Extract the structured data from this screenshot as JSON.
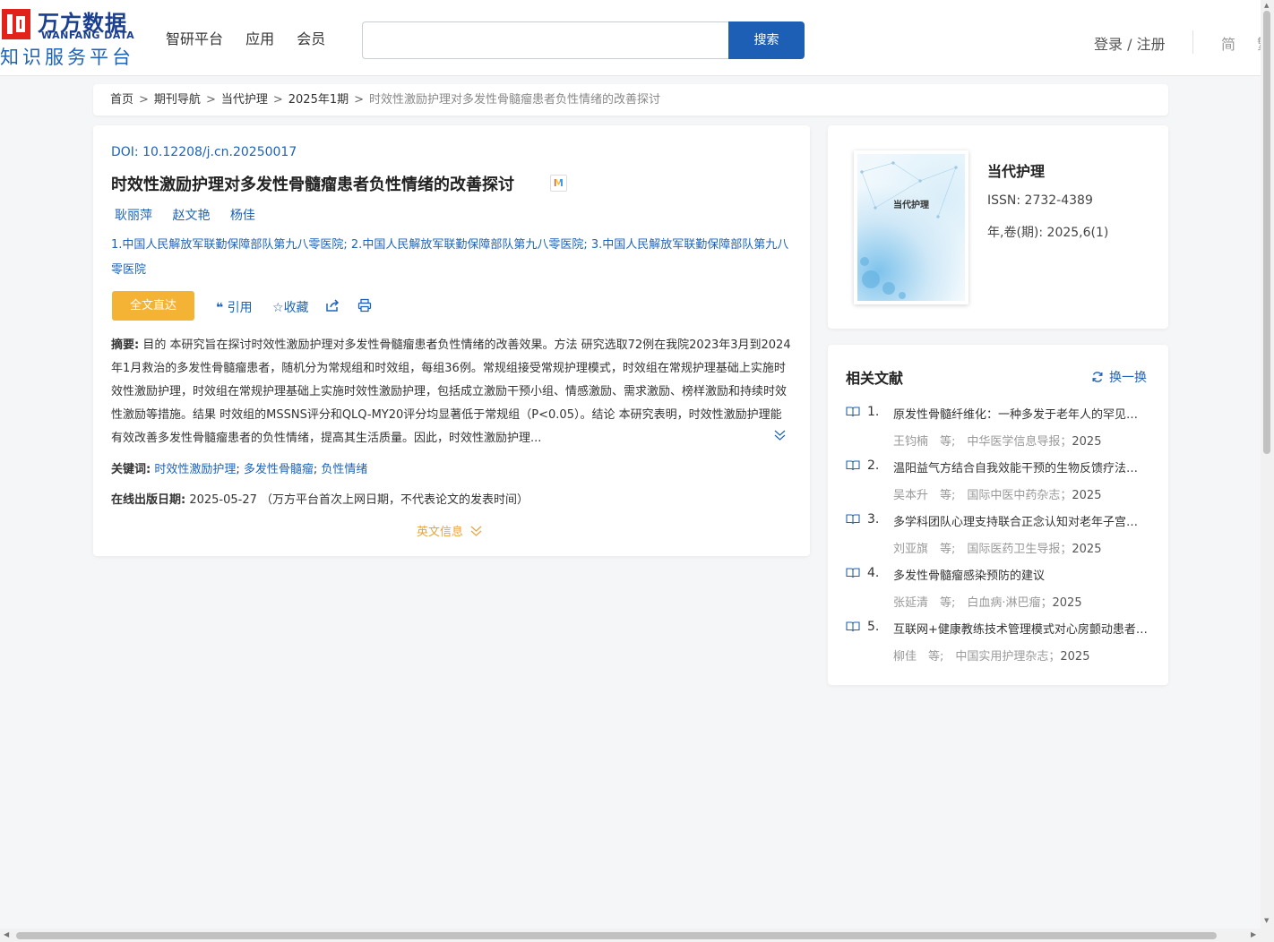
{
  "header": {
    "logo_cn": "万方数据",
    "logo_en": "WANFANG DATA",
    "logo_sub": "知识服务平台",
    "nav": [
      "智研平台",
      "应用",
      "会员"
    ],
    "search_placeholder": "",
    "search_button": "搜索",
    "login": "登录 / 注册",
    "lang": "简",
    "lang2": "繁"
  },
  "breadcrumb": {
    "items": [
      "首页",
      "期刊导航",
      "当代护理",
      "2025年1期"
    ],
    "current": "时效性激励护理对多发性骨髓瘤患者负性情绪的改善探讨",
    "sep": ">"
  },
  "article": {
    "doi_label": "DOI: ",
    "doi": "10.12208/j.cn.20250017",
    "title": "时效性激励护理对多发性骨髓瘤患者负性情绪的改善探讨",
    "badge": "M",
    "authors": [
      "耿丽萍",
      "赵文艳",
      "杨佳"
    ],
    "affiliations": "1.中国人民解放军联勤保障部队第九八零医院; 2.中国人民解放军联勤保障部队第九八零医院; 3.中国人民解放军联勤保障部队第九八零医院",
    "full_text_button": "全文直达",
    "actions": {
      "cite": "引用",
      "collect": "收藏"
    },
    "abstract_label": "摘要:",
    "abstract": "目的 本研究旨在探讨时效性激励护理对多发性骨髓瘤患者负性情绪的改善效果。方法 研究选取72例在我院2023年3月到2024年1月救治的多发性骨髓瘤患者，随机分为常规组和时效组，每组36例。常规组接受常规护理模式，时效组在常规护理基础上实施时效性激励护理，时效组在常规护理基础上实施时效性激励护理，包括成立激励干预小组、情感激励、需求激励、榜样激励和持续时效性激励等措施。结果 时效组的MSSNS评分和QLQ-MY20评分均显著低于常规组（P<0.05）。结论 本研究表明，时效性激励护理能有效改善多发性骨髓瘤患者的负性情绪，提高其生活质量。因此，时效性激励护理...",
    "keywords_label": "关键词:",
    "keywords": [
      "时效性激励护理",
      "多发性骨髓瘤",
      "负性情绪"
    ],
    "pubdate_label": "在线出版日期:",
    "pubdate": "2025-05-27",
    "pubdate_note": "（万方平台首次上网日期，不代表论文的发表时间）",
    "english_info": "英文信息"
  },
  "journal": {
    "cover_title": "当代护理",
    "name": "当代护理",
    "issn": "ISSN:  2732-4389",
    "year": "年,卷(期):  2025,6(1)"
  },
  "related": {
    "title": "相关文献",
    "refresh": "换一换",
    "items": [
      {
        "num": "1.",
        "title": "原发性骨髓纤维化：一种多发于老年人的罕见骨髓增殖性肿瘤",
        "meta": "王钧楠　等;　中华医学信息导报；",
        "year": "2025"
      },
      {
        "num": "2.",
        "title": "温阳益气方结合自我效能干预的生物反馈疗法对多发性骨髓瘤患者",
        "meta": "吴本升　等;　国际中医中药杂志；",
        "year": "2025"
      },
      {
        "num": "3.",
        "title": "多学科团队心理支持联合正念认知对老年子宫颈癌患者的影响",
        "meta": "刘亚旗　等;　国际医药卫生导报；",
        "year": "2025"
      },
      {
        "num": "4.",
        "title": "多发性骨髓瘤感染预防的建议",
        "meta": "张延清　等;　白血病·淋巴瘤；",
        "year": "2025"
      },
      {
        "num": "5.",
        "title": "互联网+健康教练技术管理模式对心房颤动患者的影响研究",
        "meta": "柳佳　等;　中国实用护理杂志；",
        "year": "2025"
      }
    ]
  }
}
